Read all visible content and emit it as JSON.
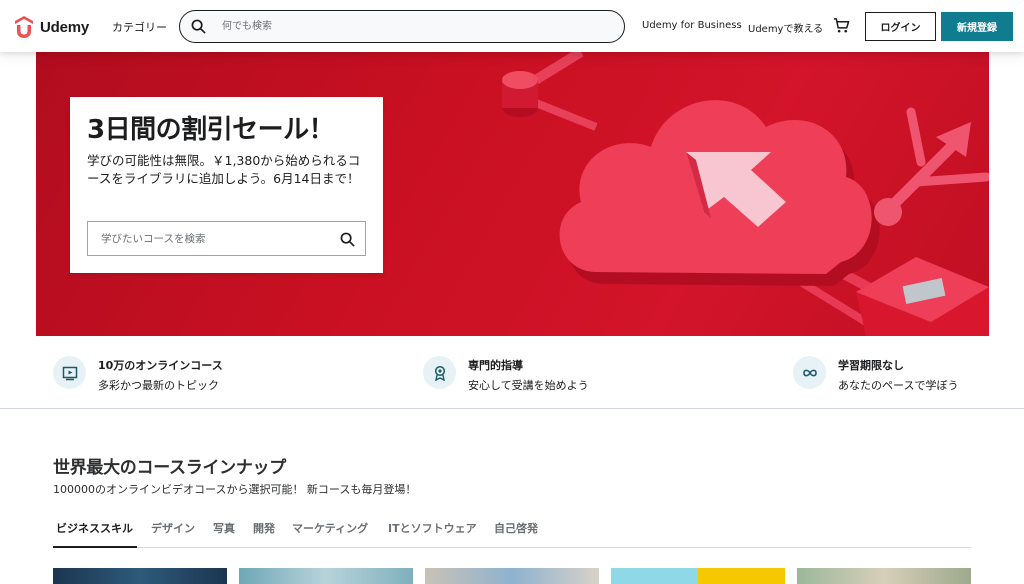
{
  "header": {
    "logo_text": "Udemy",
    "categories": "カテゴリー",
    "search_placeholder": "何でも検索",
    "business": "Udemy for Business",
    "teach": "Udemyで教える",
    "login": "ログイン",
    "signup": "新規登録"
  },
  "hero": {
    "title": "3日間の割引セール！",
    "body": "学びの可能性は無限。￥1,380から始められるコースをライブラリに追加しよう。6月14日まで！",
    "search_placeholder": "学びたいコースを検索"
  },
  "props": [
    {
      "title": "10万のオンラインコース",
      "sub": "多彩かつ最新のトピック",
      "icon": "video-play-icon"
    },
    {
      "title": "専門的指導",
      "sub": "安心して受講を始めよう",
      "icon": "award-ribbon-icon"
    },
    {
      "title": "学習期限なし",
      "sub": "あなたのペースで学ぼう",
      "icon": "infinity-icon"
    }
  ],
  "section": {
    "title": "世界最大のコースラインナップ",
    "subtitle": "100000のオンラインビデオコースから選択可能！ 新コースも毎月登場！",
    "tabs": [
      {
        "label": "ビジネススキル",
        "active": true
      },
      {
        "label": "デザイン"
      },
      {
        "label": "写真"
      },
      {
        "label": "開発"
      },
      {
        "label": "マーケティング"
      },
      {
        "label": "ITとソフトウェア"
      },
      {
        "label": "自己啓発"
      }
    ]
  },
  "colors": {
    "brand": "#a435f0",
    "logo_red": "#ec5252",
    "primary_button": "#0f7c90",
    "hero_red": "#c91022"
  }
}
